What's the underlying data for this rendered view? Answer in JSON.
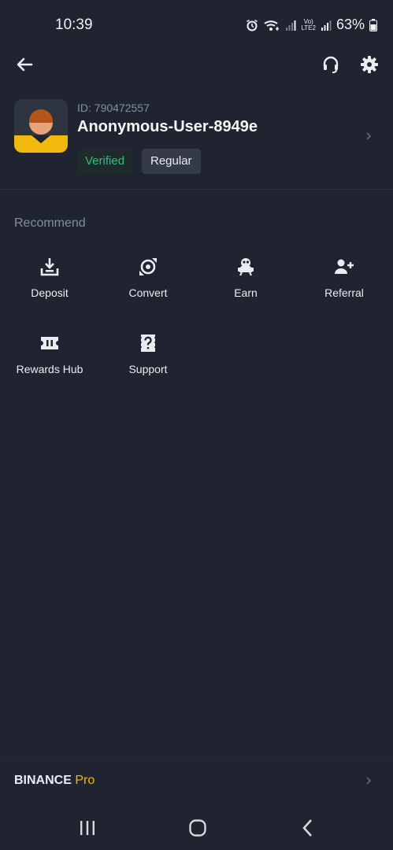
{
  "status_bar": {
    "time": "10:39",
    "network_label_top": "Vo)",
    "network_label_bottom": "LTE2",
    "battery": "63%"
  },
  "profile": {
    "id_text": "ID: 790472557",
    "username": "Anonymous-User-8949e",
    "badge_verified": "Verified",
    "badge_level": "Regular"
  },
  "recommend": {
    "title": "Recommend",
    "items": [
      {
        "label": "Deposit",
        "icon": "deposit-icon"
      },
      {
        "label": "Convert",
        "icon": "convert-icon"
      },
      {
        "label": "Earn",
        "icon": "earn-icon"
      },
      {
        "label": "Referral",
        "icon": "referral-icon"
      },
      {
        "label": "Rewards Hub",
        "icon": "ticket-icon"
      },
      {
        "label": "Support",
        "icon": "support-icon"
      }
    ]
  },
  "footer": {
    "brand": "BINANCE",
    "brand_suffix": "Pro"
  },
  "colors": {
    "background": "#1f2430",
    "verified_green": "#2ebd85",
    "brand_yellow": "#f0b90b",
    "muted_text": "#848e9c"
  }
}
